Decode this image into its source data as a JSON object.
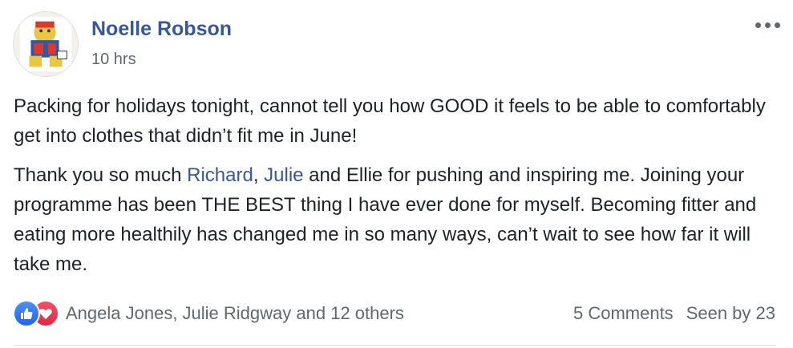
{
  "post": {
    "author": "Noelle Robson",
    "timestamp": "10 hrs",
    "paragraph1": "Packing for holidays tonight, cannot tell you how GOOD it feels to be able to comfortably get into clothes that didn’t fit me in June!",
    "paragraph2": {
      "part1": "Thank you so much ",
      "mention1": "Richard",
      "part2": ", ",
      "mention2": "Julie",
      "part3": " and Ellie for pushing and inspiring me. Joining your programme has been THE BEST thing I have ever done for myself. Becoming fitter and eating more healthily has changed me in so many ways, can’t wait to see how far it will take me."
    }
  },
  "footer": {
    "reactions": [
      "like-icon",
      "love-icon"
    ],
    "reactors_text": "Angela Jones, Julie Ridgway and 12 others",
    "comments": "5 Comments",
    "seen_by": "Seen by 23"
  },
  "colors": {
    "link": "#365899",
    "text": "#1d2129",
    "meta": "#616770",
    "like": "#1f65e6",
    "love": "#e02843"
  }
}
